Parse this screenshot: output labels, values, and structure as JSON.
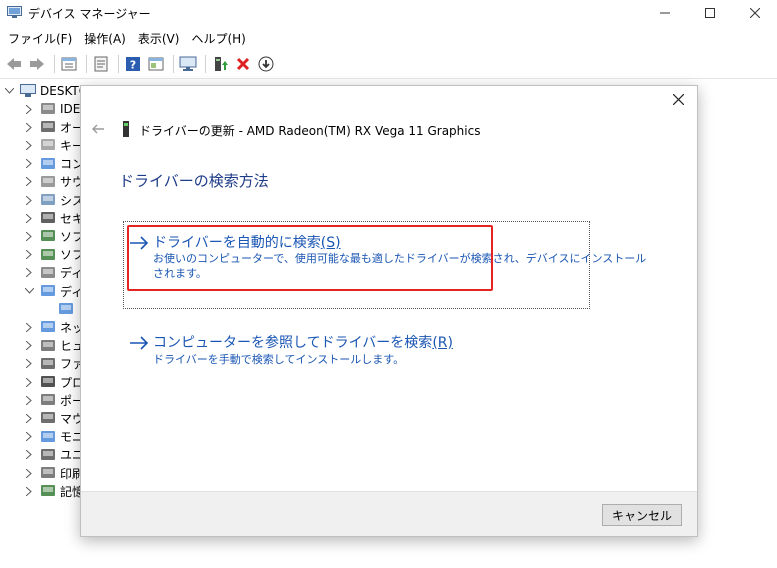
{
  "window": {
    "title": "デバイス マネージャー"
  },
  "menu": [
    "ファイル(F)",
    "操作(A)",
    "表示(V)",
    "ヘルプ(H)"
  ],
  "tree": {
    "root": "DESKTO",
    "items": [
      {
        "label": "IDE",
        "icon": "ide-icon"
      },
      {
        "label": "オー",
        "icon": "audio-icon"
      },
      {
        "label": "キー",
        "icon": "keyboard-icon"
      },
      {
        "label": "コン",
        "icon": "computer-icon"
      },
      {
        "label": "サウ",
        "icon": "sound-icon"
      },
      {
        "label": "シス",
        "icon": "system-icon"
      },
      {
        "label": "セキ",
        "icon": "security-icon"
      },
      {
        "label": "ソフ",
        "icon": "software-icon"
      },
      {
        "label": "ソフ",
        "icon": "software-device-icon"
      },
      {
        "label": "ディ",
        "icon": "disk-icon"
      },
      {
        "label": "ディ",
        "icon": "display-adapter-icon"
      },
      {
        "label": "",
        "icon": "display-adapter-child-icon"
      },
      {
        "label": "ネッ",
        "icon": "network-icon"
      },
      {
        "label": "ヒュ",
        "icon": "hid-icon"
      },
      {
        "label": "ファ",
        "icon": "firmware-icon"
      },
      {
        "label": "プロ",
        "icon": "processor-icon"
      },
      {
        "label": "ポー",
        "icon": "port-icon"
      },
      {
        "label": "マウ",
        "icon": "mouse-icon"
      },
      {
        "label": "モニ",
        "icon": "monitor-icon"
      },
      {
        "label": "ユニ",
        "icon": "usb-icon"
      },
      {
        "label": "印刷",
        "icon": "print-icon"
      },
      {
        "label": "記憶",
        "icon": "storage-icon"
      }
    ]
  },
  "dialog": {
    "title": "ドライバーの更新 - AMD Radeon(TM) RX Vega 11 Graphics",
    "heading": "ドライバーの検索方法",
    "option1": {
      "title": "ドライバーを自動的に検索",
      "shortcut": "(S)",
      "desc_line1": "お使いのコンピューターで、使用可能な最も適したドライバーが検索され、デバイスにインストール",
      "desc_line2": "されます。"
    },
    "option2": {
      "title": "コンピューターを参照してドライバーを検索",
      "shortcut": "(R)",
      "desc": "ドライバーを手動で検索してインストールします。"
    },
    "cancel_label": "キャンセル"
  },
  "colors": {
    "link": "#1a56b3",
    "heading": "#1f3c88",
    "highlight": "#e52421"
  }
}
